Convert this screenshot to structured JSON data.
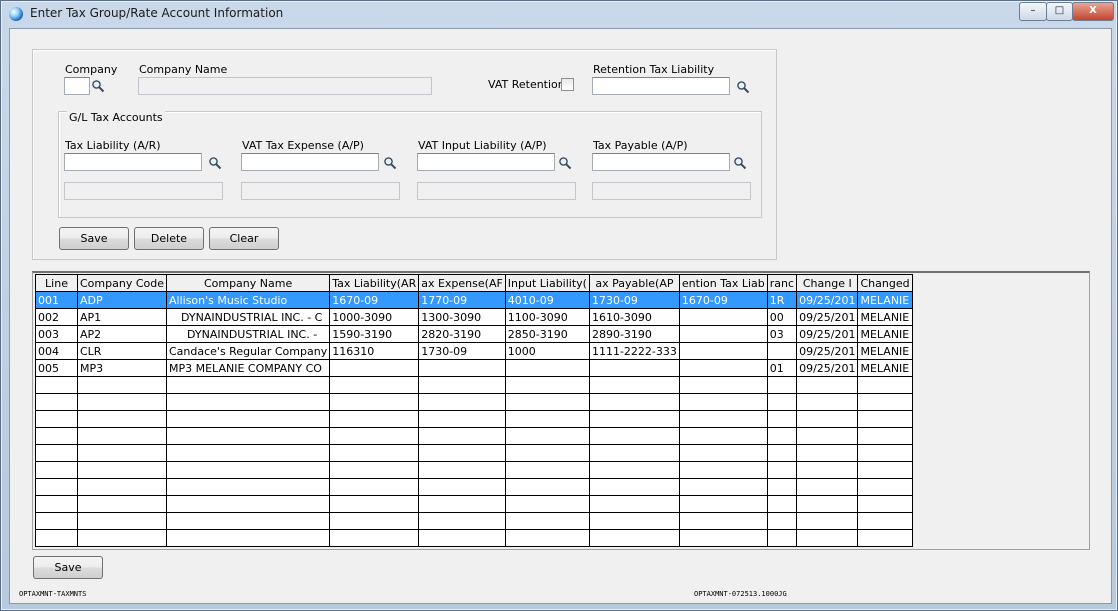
{
  "window": {
    "title": "Enter Tax Group/Rate Account Information",
    "minimize": "–",
    "maximize": "□",
    "close": "X"
  },
  "form": {
    "company_label": "Company",
    "company_value": "",
    "company_name_label": "Company Name",
    "company_name_value": "",
    "vat_retention_label": "VAT Retention",
    "vat_retention_checked": false,
    "retention_tax_liability_label": "Retention Tax Liability",
    "retention_tax_liability_value": "",
    "gl_group_title": "G/L Tax Accounts",
    "tax_liability_label": "Tax Liability (A/R)",
    "vat_tax_expense_label": "VAT Tax Expense (A/P)",
    "vat_input_liability_label": "VAT Input Liability (A/P)",
    "tax_payable_label": "Tax Payable (A/P)",
    "save_label": "Save",
    "delete_label": "Delete",
    "clear_label": "Clear"
  },
  "grid": {
    "columns": [
      "Line",
      "Company Code",
      "Company Name",
      "Tax Liability(AR",
      "ax Expense(AF",
      "Input Liability(",
      "ax Payable(AP",
      "ention Tax Liab",
      "ranc",
      "Change I",
      "Changed"
    ],
    "rows": [
      [
        "001",
        "ADP",
        "Allison's Music Studio",
        "1670-09",
        "1770-09",
        "4010-09",
        "1730-09",
        "1670-09",
        "1R",
        "09/25/201",
        "MELANIE"
      ],
      [
        "002",
        "AP1",
        "DYNAINDUSTRIAL INC. - C",
        "1000-3090",
        "1300-3090",
        "1100-3090",
        "1610-3090",
        "",
        "00",
        "09/25/201",
        "MELANIE"
      ],
      [
        "003",
        "AP2",
        "DYNAINDUSTRIAL INC. -",
        "1590-3190",
        "2820-3190",
        "2850-3190",
        "2890-3190",
        "",
        "03",
        "09/25/201",
        "MELANIE"
      ],
      [
        "004",
        "CLR",
        "Candace's Regular Company",
        "116310",
        "1730-09",
        "1000",
        "1111-2222-333",
        "",
        "",
        "09/25/201",
        "MELANIE"
      ],
      [
        "005",
        "MP3",
        "MP3 MELANIE COMPANY CO",
        "",
        "",
        "",
        "",
        "",
        "01",
        "09/25/201",
        "MELANIE"
      ]
    ],
    "empty_rows": 10,
    "selected_row": 0
  },
  "bottom": {
    "save_label": "Save"
  },
  "footer": {
    "left": "OPTAXMNT-TAXMNTS",
    "right": "OPTAXMNT-072513.1000JG"
  },
  "colors": {
    "selection": "#3399ff",
    "background": "#f0f0f0"
  }
}
